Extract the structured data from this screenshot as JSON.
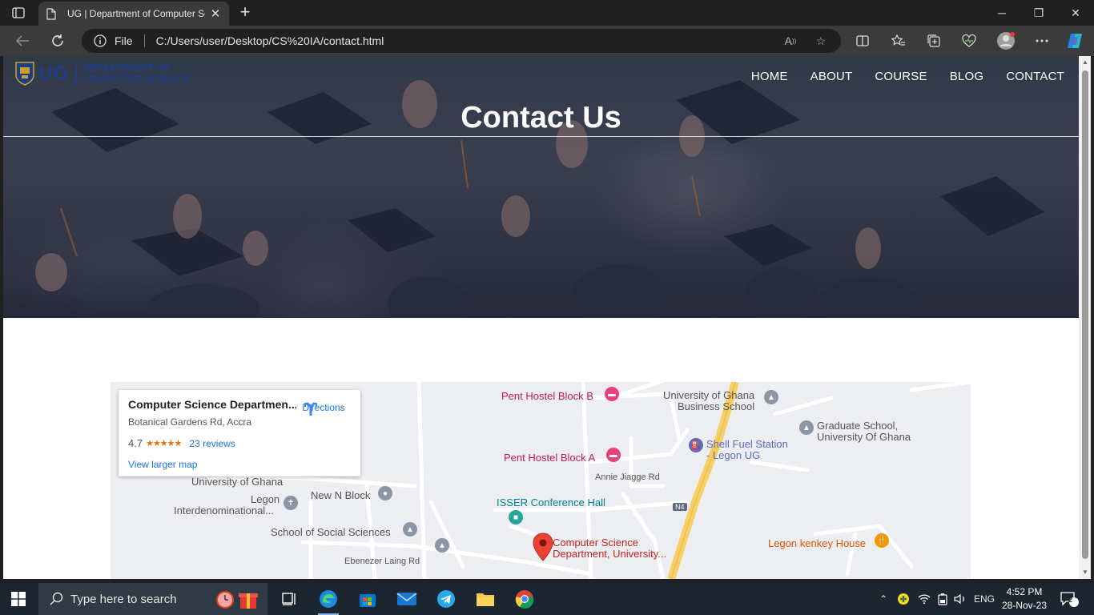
{
  "browser": {
    "tab_title": "UG | Department of Computer Science",
    "address_scheme": "File",
    "address_url": "C:/Users/user/Desktop/CS%20IA/contact.html"
  },
  "site": {
    "logo_ug": "UG",
    "logo_dept_line1": "DEPARTMENT OF",
    "logo_dept_line2": "COMPUTER SCIENCE",
    "nav": [
      {
        "label": "HOME"
      },
      {
        "label": "ABOUT"
      },
      {
        "label": "COURSE"
      },
      {
        "label": "BLOG"
      },
      {
        "label": "CONTACT"
      }
    ],
    "hero_title": "Contact Us"
  },
  "map": {
    "card": {
      "title": "Computer Science Departmen...",
      "address": "Botanical Gardens Rd, Accra",
      "rating": "4.7",
      "stars": "★★★★★",
      "reviews": "23 reviews",
      "directions": "Directions",
      "view_larger": "View larger map"
    },
    "places": {
      "pent_b": "Pent Hostel Block B",
      "pent_a": "Pent Hostel Block A",
      "business_school_1": "University of Ghana",
      "business_school_2": "Business School",
      "graduate_1": "Graduate School,",
      "graduate_2": "University Of Ghana",
      "shell_1": "Shell Fuel Station",
      "shell_2": "- Legon UG",
      "annie": "Annie Jiagge Rd",
      "isser": "ISSER Conference Hall",
      "ug_small": "University of Ghana",
      "legon_1": "Legon",
      "legon_2": "Interdenominational...",
      "new_n": "New N Block",
      "social": "School of Social Sciences",
      "ebenezer": "Ebenezer Laing Rd",
      "cs_1": "Computer Science",
      "cs_2": "Department, University...",
      "kenkey": "Legon kenkey House",
      "n4": "N4"
    }
  },
  "taskbar": {
    "search_placeholder": "Type here to search",
    "lang": "ENG",
    "time": "4:52 PM",
    "date": "28-Nov-23",
    "notifications": "2"
  },
  "colors": {
    "accent": "#1c3e86",
    "map_bg": "#eceef1",
    "highway": "#f6cf65"
  }
}
